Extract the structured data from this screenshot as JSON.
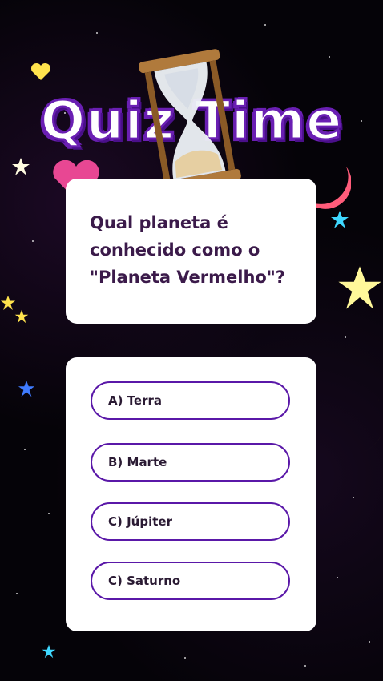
{
  "title": "Quiz Time",
  "question": "Qual planeta é conhecido como o \"Planeta Vermelho\"?",
  "options": [
    {
      "label": "A) Terra"
    },
    {
      "label": "B) Marte"
    },
    {
      "label": "C) Júpiter"
    },
    {
      "label": "C) Saturno"
    }
  ],
  "colors": {
    "accent": "#5a18a8",
    "title_outline": "#6a1fb3",
    "card": "#ffffff",
    "question_text": "#3b1a4a"
  },
  "icons": [
    "hourglass-icon",
    "moon-icon",
    "star-icon",
    "heart-icon"
  ]
}
